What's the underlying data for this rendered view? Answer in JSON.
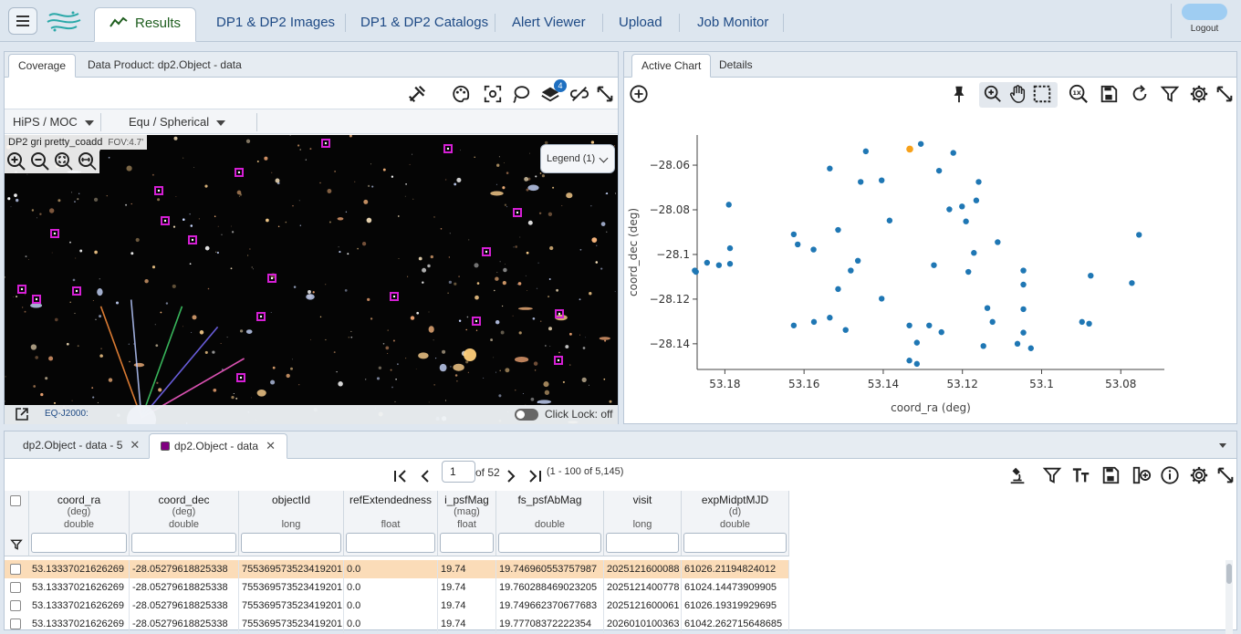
{
  "header": {
    "tabs": [
      {
        "label": "Results"
      },
      {
        "label": "DP1 & DP2 Images"
      },
      {
        "label": "DP1 & DP2 Catalogs"
      },
      {
        "label": "Alert Viewer"
      },
      {
        "label": "Upload"
      },
      {
        "label": "Job Monitor"
      }
    ],
    "logout": "Logout"
  },
  "coverage": {
    "tabs": [
      {
        "label": "Coverage"
      },
      {
        "label": "Data Product: dp2.Object - data"
      }
    ],
    "layers_badge": "4",
    "hips_select": "HiPS / MOC",
    "coord_select": "Equ / Spherical",
    "image_title": "DP2 gri pretty_coadd",
    "fov": "FOV:4.7'",
    "legend": "Legend (1)",
    "coord_readout": "EQ-J2000:",
    "click_lock": "Click Lock: off"
  },
  "chart": {
    "tabs": [
      {
        "label": "Active Chart"
      },
      {
        "label": "Details"
      }
    ]
  },
  "chart_data": {
    "type": "scatter",
    "xlabel": "coord_ra (deg)",
    "ylabel": "coord_dec (deg)",
    "xlim": [
      53.187,
      53.069
    ],
    "ylim": [
      -28.1515,
      -28.0465
    ],
    "x_ticks": [
      "53.18",
      "53.16",
      "53.14",
      "53.12",
      "53.1",
      "53.08"
    ],
    "x_tick_values": [
      53.18,
      53.16,
      53.14,
      53.12,
      53.1,
      53.08
    ],
    "y_ticks": [
      "−28.06",
      "−28.08",
      "−28.1",
      "−28.12",
      "−28.14"
    ],
    "y_tick_values": [
      -28.06,
      -28.08,
      -28.1,
      -28.12,
      -28.14
    ],
    "highlight": {
      "x": 53.1333,
      "y": -28.0528
    },
    "points": [
      {
        "x": 53.1305,
        "y": -28.0505
      },
      {
        "x": 53.1223,
        "y": -28.0545
      },
      {
        "x": 53.1444,
        "y": -28.0538
      },
      {
        "x": 53.1535,
        "y": -28.0615
      },
      {
        "x": 53.1259,
        "y": -28.0625
      },
      {
        "x": 53.1404,
        "y": -28.0668
      },
      {
        "x": 53.1457,
        "y": -28.0675
      },
      {
        "x": 53.1159,
        "y": -28.0675
      },
      {
        "x": 53.1165,
        "y": -28.0758
      },
      {
        "x": 53.179,
        "y": -28.0777
      },
      {
        "x": 53.1233,
        "y": -28.0798
      },
      {
        "x": 53.1201,
        "y": -28.0785
      },
      {
        "x": 53.1191,
        "y": -28.0852
      },
      {
        "x": 53.1384,
        "y": -28.0848
      },
      {
        "x": 53.1514,
        "y": -28.089
      },
      {
        "x": 53.1626,
        "y": -28.091
      },
      {
        "x": 53.1616,
        "y": -28.0955
      },
      {
        "x": 53.1111,
        "y": -28.0945
      },
      {
        "x": 53.0754,
        "y": -28.0912
      },
      {
        "x": 53.1576,
        "y": -28.0978
      },
      {
        "x": 53.1787,
        "y": -28.0972
      },
      {
        "x": 53.1171,
        "y": -28.0993
      },
      {
        "x": 53.1464,
        "y": -28.1028
      },
      {
        "x": 53.1845,
        "y": -28.1037
      },
      {
        "x": 53.1815,
        "y": -28.1048
      },
      {
        "x": 53.1787,
        "y": -28.1042
      },
      {
        "x": 53.1272,
        "y": -28.1048
      },
      {
        "x": 53.1482,
        "y": -28.1072
      },
      {
        "x": 53.1185,
        "y": -28.1078
      },
      {
        "x": 53.1046,
        "y": -28.1072
      },
      {
        "x": 53.1873,
        "y": -28.1078
      },
      {
        "x": 53.1876,
        "y": -28.1072
      },
      {
        "x": 53.0876,
        "y": -28.1095
      },
      {
        "x": 53.1046,
        "y": -28.1135
      },
      {
        "x": 53.0772,
        "y": -28.1128
      },
      {
        "x": 53.1514,
        "y": -28.1155
      },
      {
        "x": 53.1404,
        "y": -28.1198
      },
      {
        "x": 53.1137,
        "y": -28.124
      },
      {
        "x": 53.1046,
        "y": -28.1245
      },
      {
        "x": 53.1535,
        "y": -28.1283
      },
      {
        "x": 53.1124,
        "y": -28.1302
      },
      {
        "x": 53.0898,
        "y": -28.1302
      },
      {
        "x": 53.088,
        "y": -28.131
      },
      {
        "x": 53.1626,
        "y": -28.1318
      },
      {
        "x": 53.1575,
        "y": -28.1302
      },
      {
        "x": 53.1334,
        "y": -28.1318
      },
      {
        "x": 53.1284,
        "y": -28.1318
      },
      {
        "x": 53.1495,
        "y": -28.1338
      },
      {
        "x": 53.1253,
        "y": -28.1348
      },
      {
        "x": 53.1046,
        "y": -28.135
      },
      {
        "x": 53.1315,
        "y": -28.1395
      },
      {
        "x": 53.1061,
        "y": -28.14
      },
      {
        "x": 53.1147,
        "y": -28.141
      },
      {
        "x": 53.1027,
        "y": -28.142
      },
      {
        "x": 53.1334,
        "y": -28.1475
      },
      {
        "x": 53.1315,
        "y": -28.149
      }
    ]
  },
  "table": {
    "tabs": [
      {
        "label": "dp2.Object - data - 5"
      },
      {
        "label": "dp2.Object - data"
      }
    ],
    "page": "1",
    "of_pages": "of 52",
    "range": "(1 - 100 of 5,145)",
    "columns": [
      {
        "name": "coord_ra",
        "unit": "(deg)",
        "type": "double"
      },
      {
        "name": "coord_dec",
        "unit": "(deg)",
        "type": "double"
      },
      {
        "name": "objectId",
        "unit": "",
        "type": "long"
      },
      {
        "name": "refExtendedness",
        "unit": "",
        "type": "float"
      },
      {
        "name": "i_psfMag",
        "unit": "(mag)",
        "type": "float"
      },
      {
        "name": "fs_psfAbMag",
        "unit": "",
        "type": "double"
      },
      {
        "name": "visit",
        "unit": "",
        "type": "long"
      },
      {
        "name": "expMidptMJD",
        "unit": "(d)",
        "type": "double"
      }
    ],
    "rows": [
      [
        "53.13337021626269",
        "-28.05279618825338",
        "755369573523419201",
        "0.0",
        "19.74",
        "19.746960553757987",
        "2025121600088",
        "61026.21194824012"
      ],
      [
        "53.13337021626269",
        "-28.05279618825338",
        "755369573523419201",
        "0.0",
        "19.74",
        "19.760288469023205",
        "2025121400778",
        "61024.14473909905"
      ],
      [
        "53.13337021626269",
        "-28.05279618825338",
        "755369573523419201",
        "0.0",
        "19.74",
        "19.749662370677683",
        "2025121600061",
        "61026.19319929695"
      ],
      [
        "53.13337021626269",
        "-28.05279618825338",
        "755369573523419201",
        "0.0",
        "19.74",
        "19.77708372222354",
        "2026010100363",
        "61042.262715648685"
      ]
    ]
  }
}
